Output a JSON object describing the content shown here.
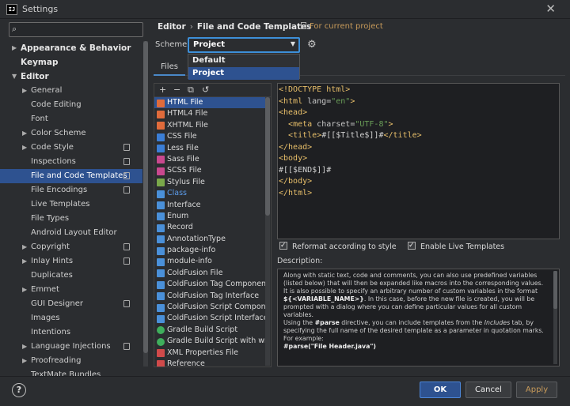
{
  "window": {
    "title": "Settings",
    "close": "✕"
  },
  "search": {
    "placeholder": "",
    "icon": "search-icon"
  },
  "tree": [
    {
      "label": "Appearance & Behavior",
      "bold": true,
      "arrow": "▶",
      "indent": 0
    },
    {
      "label": "Keymap",
      "bold": true,
      "arrow": "",
      "indent": 0
    },
    {
      "label": "Editor",
      "bold": true,
      "arrow": "▼",
      "indent": 0
    },
    {
      "label": "General",
      "arrow": "▶",
      "indent": 1
    },
    {
      "label": "Code Editing",
      "arrow": "",
      "indent": 1
    },
    {
      "label": "Font",
      "arrow": "",
      "indent": 1
    },
    {
      "label": "Color Scheme",
      "arrow": "▶",
      "indent": 1
    },
    {
      "label": "Code Style",
      "arrow": "▶",
      "indent": 1,
      "copy": true
    },
    {
      "label": "Inspections",
      "arrow": "",
      "indent": 1,
      "copy": true
    },
    {
      "label": "File and Code Templates",
      "arrow": "",
      "indent": 1,
      "copy": true,
      "selected": true
    },
    {
      "label": "File Encodings",
      "arrow": "",
      "indent": 1,
      "copy": true
    },
    {
      "label": "Live Templates",
      "arrow": "",
      "indent": 1
    },
    {
      "label": "File Types",
      "arrow": "",
      "indent": 1
    },
    {
      "label": "Android Layout Editor",
      "arrow": "",
      "indent": 1
    },
    {
      "label": "Copyright",
      "arrow": "▶",
      "indent": 1,
      "copy": true
    },
    {
      "label": "Inlay Hints",
      "arrow": "▶",
      "indent": 1,
      "copy": true
    },
    {
      "label": "Duplicates",
      "arrow": "",
      "indent": 1
    },
    {
      "label": "Emmet",
      "arrow": "▶",
      "indent": 1
    },
    {
      "label": "GUI Designer",
      "arrow": "",
      "indent": 1,
      "copy": true
    },
    {
      "label": "Images",
      "arrow": "",
      "indent": 1
    },
    {
      "label": "Intentions",
      "arrow": "",
      "indent": 1
    },
    {
      "label": "Language Injections",
      "arrow": "▶",
      "indent": 1,
      "copy": true
    },
    {
      "label": "Proofreading",
      "arrow": "▶",
      "indent": 1
    },
    {
      "label": "TextMate Bundles",
      "arrow": "",
      "indent": 1
    }
  ],
  "breadcrumb": {
    "parent": "Editor",
    "sep": "›",
    "current": "File and Code Templates"
  },
  "for_current_project": "For current project",
  "scheme": {
    "label": "Scheme:",
    "value": "Project",
    "options": [
      "Default",
      "Project"
    ],
    "selected_index": 1
  },
  "tabs": [
    {
      "label": "Files"
    }
  ],
  "list_toolbar": {
    "add": "+",
    "remove": "−",
    "copy": "⧉",
    "reset": "↺"
  },
  "templates": [
    {
      "label": "HTML File",
      "color": "#e06b3b",
      "selected": true
    },
    {
      "label": "HTML4 File",
      "color": "#e06b3b"
    },
    {
      "label": "XHTML File",
      "color": "#e06b3b"
    },
    {
      "label": "CSS File",
      "color": "#3b7ed6"
    },
    {
      "label": "Less File",
      "color": "#3b7ed6"
    },
    {
      "label": "Sass File",
      "color": "#c9488e"
    },
    {
      "label": "SCSS File",
      "color": "#c9488e"
    },
    {
      "label": "Stylus File",
      "color": "#7aa84a"
    },
    {
      "label": "Class",
      "color": "#4a90d9",
      "blue": true
    },
    {
      "label": "Interface",
      "color": "#4a90d9"
    },
    {
      "label": "Enum",
      "color": "#4a90d9"
    },
    {
      "label": "Record",
      "color": "#4a90d9"
    },
    {
      "label": "AnnotationType",
      "color": "#4a90d9"
    },
    {
      "label": "package-info",
      "color": "#4a90d9"
    },
    {
      "label": "module-info",
      "color": "#4a90d9"
    },
    {
      "label": "ColdFusion File",
      "color": "#4a90d9"
    },
    {
      "label": "ColdFusion Tag Component",
      "color": "#4a90d9"
    },
    {
      "label": "ColdFusion Tag Interface",
      "color": "#4a90d9"
    },
    {
      "label": "ColdFusion Script Component",
      "color": "#4a90d9"
    },
    {
      "label": "ColdFusion Script Interface",
      "color": "#4a90d9"
    },
    {
      "label": "Gradle Build Script",
      "color": "#3fae5c",
      "round": true
    },
    {
      "label": "Gradle Build Script with wrapper",
      "color": "#3fae5c",
      "round": true
    },
    {
      "label": "XML Properties File",
      "color": "#d04a4a"
    },
    {
      "label": "Reference",
      "color": "#d04a4a"
    }
  ],
  "code_lines": [
    [
      [
        "tg",
        "<!DOCTYPE html>"
      ]
    ],
    [
      [
        "tg",
        "<html "
      ],
      [
        "at",
        "lang="
      ],
      [
        "av",
        "\"en\""
      ],
      [
        "tg",
        ">"
      ]
    ],
    [
      [
        "tg",
        "<head>"
      ]
    ],
    [
      [
        "at",
        "  "
      ],
      [
        "tg",
        "<meta "
      ],
      [
        "at",
        "charset="
      ],
      [
        "av",
        "\"UTF-8\""
      ],
      [
        "tg",
        ">"
      ]
    ],
    [
      [
        "at",
        "  "
      ],
      [
        "tg",
        "<title>"
      ],
      [
        "vr",
        "#[[$Title$]]#"
      ],
      [
        "tg",
        "</title>"
      ]
    ],
    [
      [
        "tg",
        "</head>"
      ]
    ],
    [
      [
        "tg",
        "<body>"
      ]
    ],
    [
      [
        "vr",
        "#[[$END$]]#"
      ]
    ],
    [
      [
        "tg",
        "</body>"
      ]
    ],
    [
      [
        "tg",
        "</html>"
      ]
    ]
  ],
  "options": {
    "reformat": "Reformat according to style",
    "live_templates": "Enable Live Templates"
  },
  "description": {
    "label": "Description:",
    "p1": "Along with static text, code and comments, you can also use predefined variables (listed below) that will then be expanded like macros into the corresponding values.",
    "p2": "It is also possible to specify an arbitrary number of custom variables in the format ",
    "p2_code": "${<VARIABLE_NAME>}",
    "p2_end": ". In this case, before the new file is created, you will be prompted with a dialog where you can define particular values for all custom variables.",
    "p3a": "Using the ",
    "p3_code": "#parse",
    "p3b": " directive, you can include templates from the ",
    "p3_it": "Includes",
    "p3c": " tab, by specifying the full name of the desired template as a parameter in quotation marks. For example:",
    "p4": "#parse(\"File Header.java\")"
  },
  "buttons": {
    "help": "?",
    "ok": "OK",
    "cancel": "Cancel",
    "apply": "Apply"
  }
}
